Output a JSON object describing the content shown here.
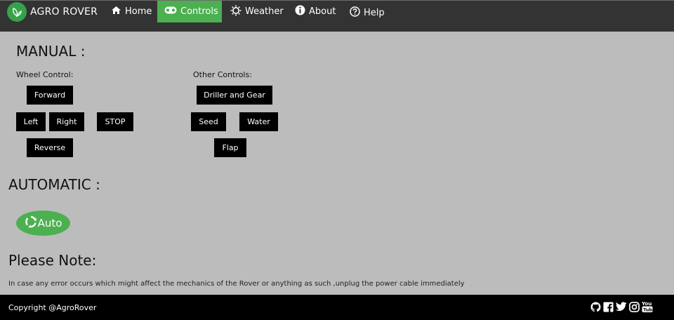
{
  "navbar": {
    "brand": "AGRO ROVER",
    "items": [
      {
        "label": "Home",
        "icon": "home-icon"
      },
      {
        "label": "Controls",
        "icon": "gamepad-icon",
        "active": true
      },
      {
        "label": "Weather",
        "icon": "sun-icon"
      },
      {
        "label": "About",
        "icon": "info-icon"
      },
      {
        "label": "Help",
        "icon": "question-icon"
      }
    ]
  },
  "manual": {
    "title": "MANUAL :",
    "wheel_label": "Wheel Control:",
    "other_label": "Other Controls:",
    "wheel_buttons": {
      "forward": "Forward",
      "left": "Left",
      "right": "Right",
      "stop": "STOP",
      "reverse": "Reverse"
    },
    "other_buttons": {
      "driller": "Driller and Gear",
      "seed": "Seed",
      "water": "Water",
      "flap": "Flap"
    }
  },
  "automatic": {
    "title": "AUTOMATIC :",
    "button": "Auto"
  },
  "note": {
    "title": "Please Note:",
    "text": "In case any error occurs which might affect the mechanics of the Rover or anything as such ,unplug the power cable immediately"
  },
  "footer": {
    "copyright": "Copyright @AgroRover",
    "socials": [
      "github-icon",
      "facebook-icon",
      "twitter-icon",
      "instagram-icon",
      "youtube-icon"
    ]
  },
  "colors": {
    "navbar_bg": "#333333",
    "accent_green": "#4caf50",
    "page_bg": "#bcbcbc",
    "button_bg": "#000000"
  }
}
